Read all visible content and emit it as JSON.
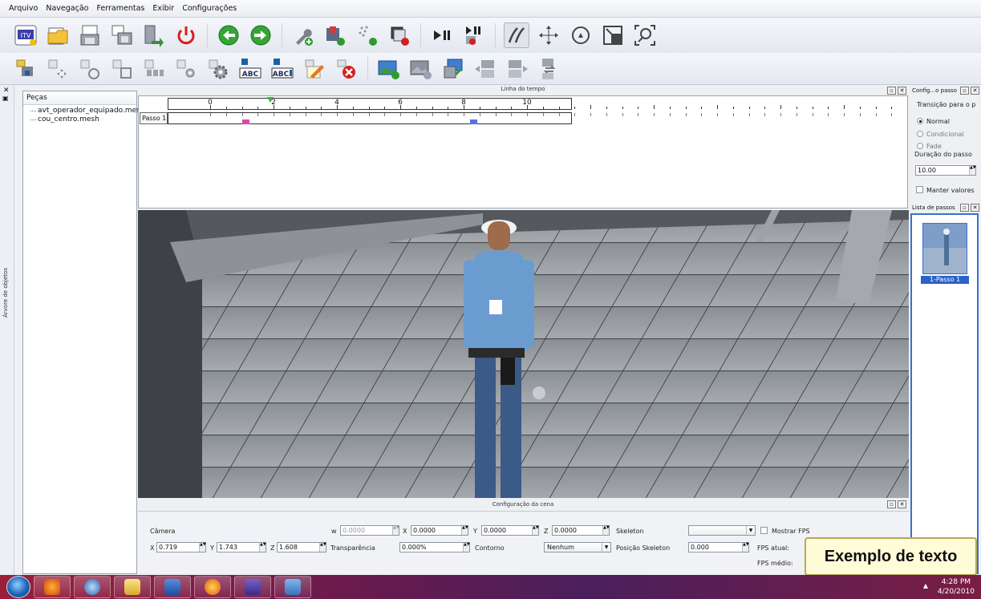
{
  "menu": [
    "Arquivo",
    "Navegação",
    "Ferramentas",
    "Exibir",
    "Configurações"
  ],
  "toolbar1": [
    {
      "icon": "itv-logo-icon"
    },
    {
      "icon": "open-folder-icon"
    },
    {
      "icon": "save-icon"
    },
    {
      "icon": "save-as-icon"
    },
    {
      "icon": "export-icon"
    },
    {
      "icon": "power-icon"
    },
    {
      "icon": "back-arrow-icon"
    },
    {
      "icon": "forward-arrow-icon"
    },
    {
      "icon": "add-tool-icon"
    },
    {
      "icon": "add-texture-icon"
    },
    {
      "icon": "add-particles-icon"
    },
    {
      "icon": "remove-object-icon"
    },
    {
      "icon": "play-pause-icon"
    },
    {
      "icon": "pause-stop-icon"
    },
    {
      "icon": "pen-icon"
    },
    {
      "icon": "move-icon"
    },
    {
      "icon": "rotate-icon"
    },
    {
      "icon": "scale-icon"
    },
    {
      "icon": "zoom-fit-icon"
    }
  ],
  "toolbar2": [
    {
      "icon": "add-piece-icon"
    },
    {
      "icon": "move-piece-icon"
    },
    {
      "icon": "rotate-piece-icon"
    },
    {
      "icon": "scale-piece-icon"
    },
    {
      "icon": "group-piece-icon"
    },
    {
      "icon": "config-piece-icon"
    },
    {
      "icon": "gear-piece-icon"
    },
    {
      "icon": "add-text-icon"
    },
    {
      "icon": "edit-text-icon"
    },
    {
      "icon": "edit-note-icon"
    },
    {
      "icon": "delete-piece-icon"
    },
    {
      "icon": "add-image-icon"
    },
    {
      "icon": "remove-image-icon"
    },
    {
      "icon": "import-image-icon"
    },
    {
      "icon": "prev-step-icon"
    },
    {
      "icon": "next-step-icon"
    },
    {
      "icon": "swap-step-icon"
    }
  ],
  "left_strip": {
    "label": "Árvore de objetos"
  },
  "tree": {
    "header": "Peças",
    "items": [
      "avt_operador_equipado.mesh",
      "cou_centro.mesh"
    ]
  },
  "timeline": {
    "title": "Linha do tempo",
    "ruler_labels": [
      "0",
      "2",
      "4",
      "6",
      "8",
      "10"
    ],
    "track_label": "Passo 1",
    "marker_color": "#d44bb0",
    "marker2_color": "#5b6fe0"
  },
  "scene": {
    "title": "Configuração da cena",
    "camera_label": "Câmera",
    "w_label": "w",
    "w_value": "0.0000",
    "x_label": "X",
    "x_value": "0.0000",
    "y_label": "Y",
    "y_value": "0.0000",
    "z_label": "Z",
    "z_value": "0.0000",
    "skeleton_label": "Skeleton",
    "skeleton_value": "",
    "show_fps_label": "Mostrar FPS",
    "cx_label": "X",
    "cx_value": "0.719",
    "cy_label": "Y",
    "cy_value": "1.743",
    "cz_label": "Z",
    "cz_value": "1.608",
    "transparency_label": "Transparência",
    "transparency_value": "0.000%",
    "contour_label": "Contorno",
    "contour_value": "Nenhum",
    "skeleton_pos_label": "Posição Skeleton",
    "skeleton_pos_value": "0.000",
    "fps_current_label": "FPS atual:",
    "fps_avg_label": "FPS médio:"
  },
  "config": {
    "title": "Config...o passo",
    "transition_label": "Transição para o p",
    "options": [
      "Normal",
      "Condicional",
      "Fade"
    ],
    "selected": "Normal",
    "duration_label": "Duração do passo",
    "duration_value": "10.00",
    "keep_values_label": "Manter valores"
  },
  "steps": {
    "title": "Lista de passos",
    "items": [
      "1-Passo 1"
    ]
  },
  "tooltip": "Exemplo de texto",
  "clock": {
    "time": "4:28 PM",
    "date": "4/20/2010"
  },
  "colors": {
    "accent": "#2b62c6",
    "taskbar": "#7a1d44"
  }
}
